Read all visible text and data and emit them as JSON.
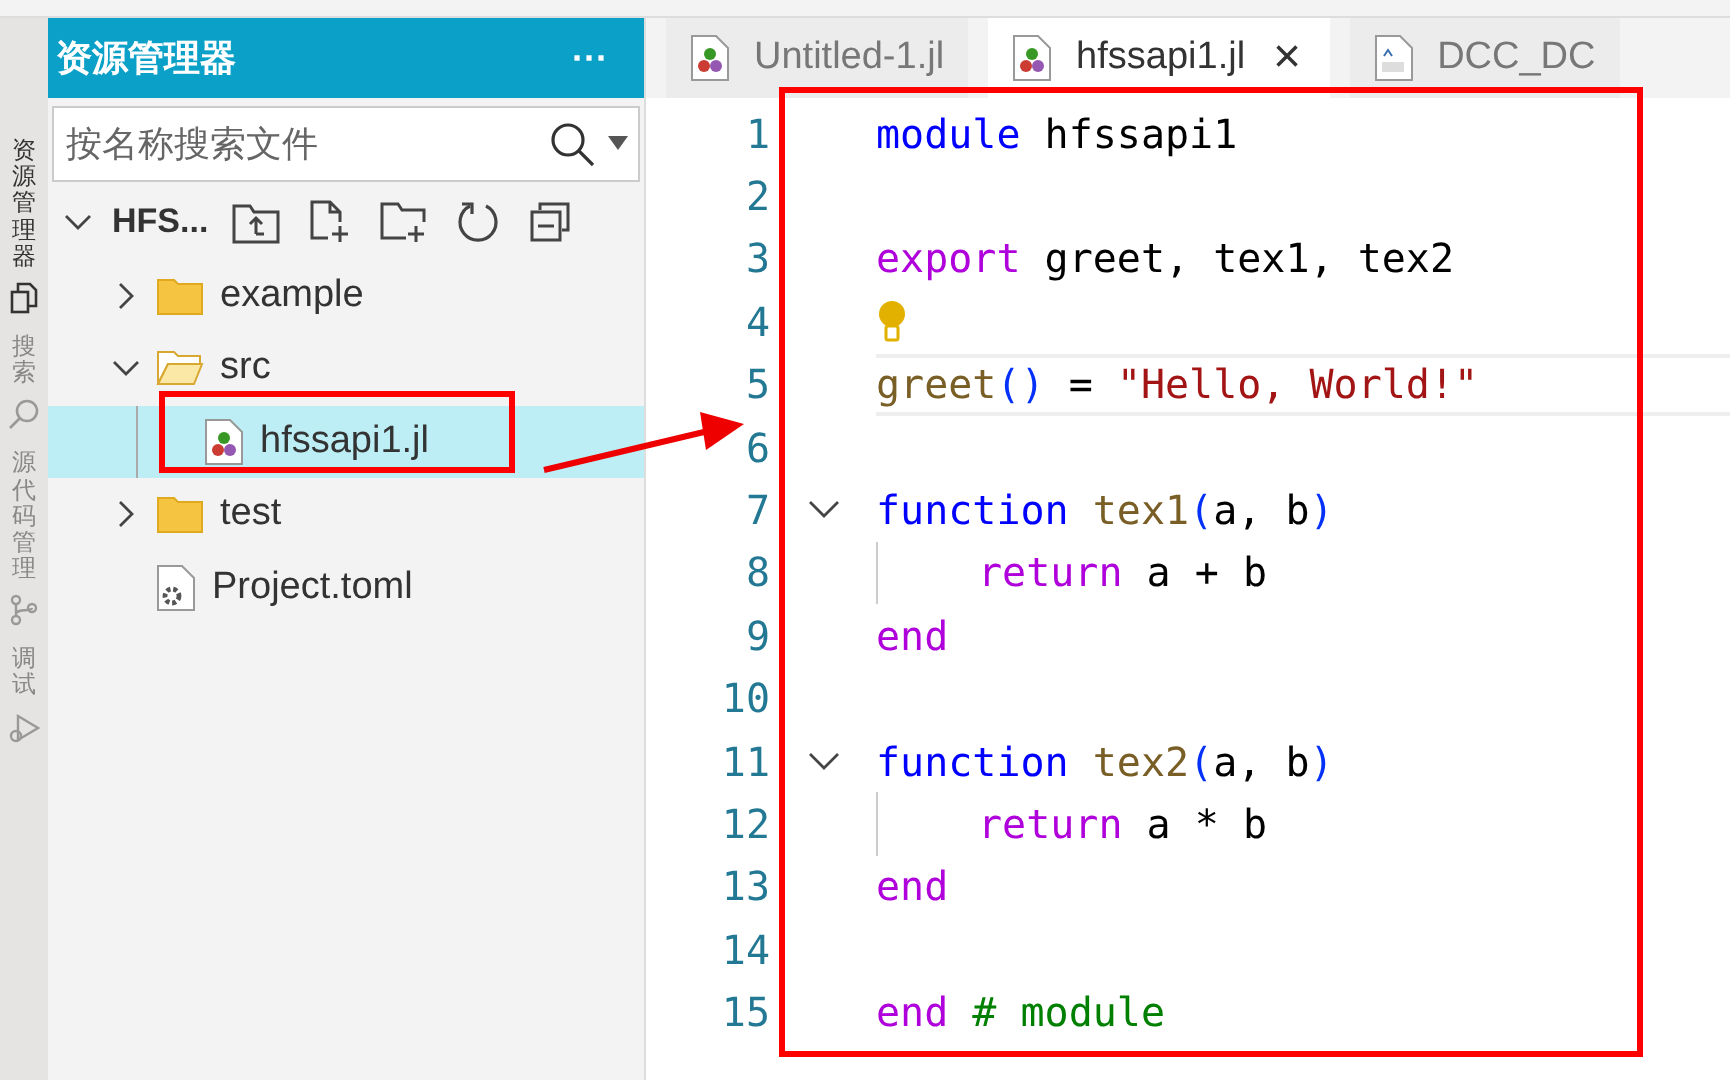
{
  "activity_bar": [
    {
      "label": "资源管理器",
      "kind": "files",
      "selected": true
    },
    {
      "label": "搜索",
      "kind": "search",
      "selected": false
    },
    {
      "label": "源代码管理",
      "kind": "branch",
      "selected": false
    },
    {
      "label": "调试",
      "kind": "debug",
      "selected": false
    }
  ],
  "sidebar": {
    "title": "资源管理器",
    "more": "···",
    "search": {
      "placeholder": "按名称搜索文件"
    },
    "project": {
      "name": "HFS...",
      "expanded": true,
      "children": [
        {
          "name": "example",
          "kind": "folder",
          "expanded": false,
          "selected": false
        },
        {
          "name": "src",
          "kind": "folder",
          "expanded": true,
          "selected": false,
          "children": [
            {
              "name": "hfssapi1.jl",
              "kind": "julia",
              "selected": true
            }
          ]
        },
        {
          "name": "test",
          "kind": "folder",
          "expanded": false,
          "selected": false
        },
        {
          "name": "Project.toml",
          "kind": "toml",
          "selected": false
        }
      ]
    }
  },
  "tabs": [
    {
      "label": "Untitled-1.jl",
      "kind": "julia",
      "selected": false
    },
    {
      "label": "hfssapi1.jl",
      "kind": "julia",
      "selected": true,
      "close": "×"
    },
    {
      "label": "DCC_DC",
      "kind": "mo",
      "selected": false
    }
  ],
  "editor": {
    "lines": [
      {
        "number": "1",
        "tokens": [
          {
            "t": "module",
            "kind": "kw"
          },
          {
            "t": " hfssapi1",
            "kind": "plain"
          }
        ]
      },
      {
        "number": "2"
      },
      {
        "number": "3",
        "tokens": [
          {
            "t": "export",
            "kind": "ctl"
          },
          {
            "t": " greet, tex1, tex2",
            "kind": "plain"
          }
        ]
      },
      {
        "number": "4",
        "lightbulb": true
      },
      {
        "number": "5",
        "current": true,
        "tokens": [
          {
            "t": "greet",
            "kind": "fn"
          },
          {
            "t": "()",
            "kind": "paren"
          },
          {
            "t": " = ",
            "kind": "plain"
          },
          {
            "t": "\"Hello, World!\"",
            "kind": "str"
          }
        ]
      },
      {
        "number": "6"
      },
      {
        "number": "7",
        "fold": true,
        "tokens": [
          {
            "t": "function",
            "kind": "kw"
          },
          {
            "t": " tex1",
            "kind": "fn"
          },
          {
            "t": "(",
            "kind": "paren"
          },
          {
            "t": "a, b",
            "kind": "plain"
          },
          {
            "t": ")",
            "kind": "paren"
          }
        ]
      },
      {
        "number": "8",
        "guide": true,
        "tokens": [
          {
            "t": "return",
            "kind": "ctl"
          },
          {
            "t": " a + b",
            "kind": "plain"
          }
        ]
      },
      {
        "number": "9",
        "tokens": [
          {
            "t": "end",
            "kind": "ctl"
          }
        ]
      },
      {
        "number": "10"
      },
      {
        "number": "11",
        "fold": true,
        "tokens": [
          {
            "t": "function",
            "kind": "kw"
          },
          {
            "t": " tex2",
            "kind": "fn"
          },
          {
            "t": "(",
            "kind": "paren"
          },
          {
            "t": "a, b",
            "kind": "plain"
          },
          {
            "t": ")",
            "kind": "paren"
          }
        ]
      },
      {
        "number": "12",
        "guide": true,
        "tokens": [
          {
            "t": "return",
            "kind": "ctl"
          },
          {
            "t": " a * b",
            "kind": "plain"
          }
        ]
      },
      {
        "number": "13",
        "tokens": [
          {
            "t": "end",
            "kind": "ctl"
          }
        ]
      },
      {
        "number": "14"
      },
      {
        "number": "15",
        "tokens": [
          {
            "t": "end",
            "kind": "ctl"
          },
          {
            "t": " # module",
            "kind": "cmt"
          }
        ]
      }
    ]
  }
}
